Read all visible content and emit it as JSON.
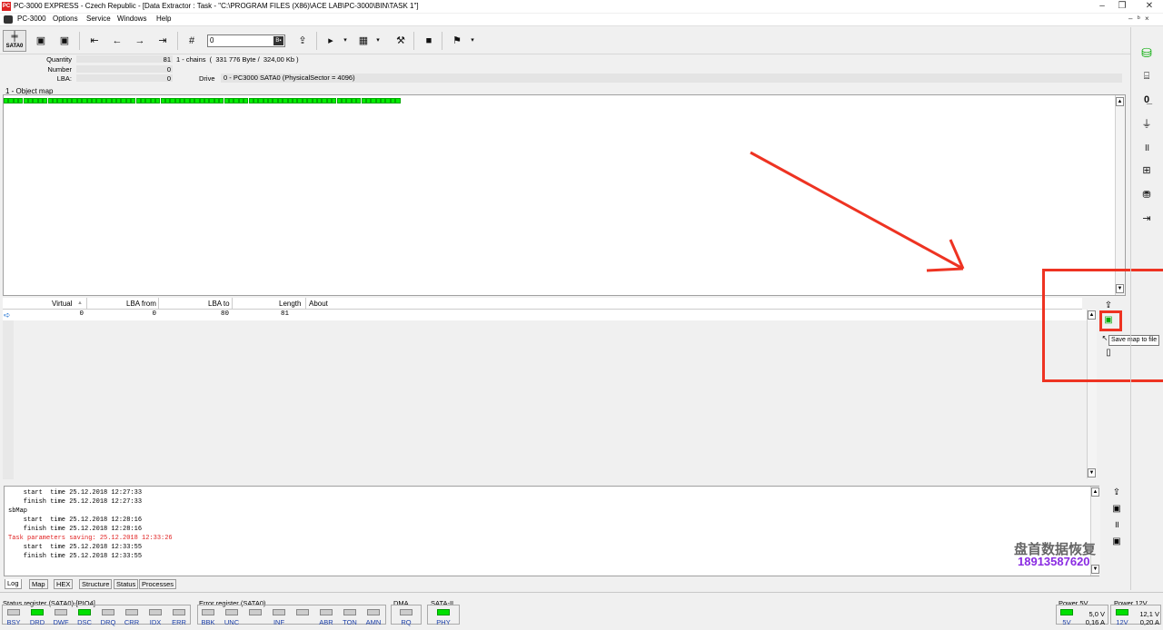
{
  "window": {
    "title": "PC-3000 EXPRESS - Czech Republic - [Data Extractor : Task - \"C:\\PROGRAM FILES (X86)\\ACE LAB\\PC-3000\\BIN\\TASK 1\"]",
    "app_icon_text": "PC",
    "minimize": "–",
    "restore": "❐",
    "close": "✕",
    "mdi_min": "–",
    "mdi_restore": "ᵇ",
    "mdi_close": "×"
  },
  "menu": {
    "items": [
      "PC-3000",
      "Options",
      "Service",
      "Windows",
      "Help"
    ]
  },
  "toolbar": {
    "sata_label": "SATA0",
    "counter_value": "0",
    "counter_btn": "B▪"
  },
  "info": {
    "quantity_label": "Quantity",
    "quantity_value": "81",
    "number_label": "Number",
    "number_value": "0",
    "lba_label": "LBA:",
    "lba_value": "0",
    "chains_text": "1 - chains  (  331 776 Byte /  324,00 Kb )",
    "drive_label": "Drive",
    "drive_value": "0 - PC3000 SATA0 (PhysicalSector = 4096)"
  },
  "object_map": {
    "label": "1 - Object map",
    "block_count": 81
  },
  "grid": {
    "columns": [
      "Virtual",
      "LBA from",
      "LBA to",
      "Length",
      "About"
    ],
    "row": {
      "virtual": "0",
      "lba_from": "0",
      "lba_to": "80",
      "length": "81",
      "about": ""
    }
  },
  "side_tools": {
    "tooltip": "Save map to file"
  },
  "log": {
    "lines": [
      {
        "text": "    start  time 25.12.2018 12:27:33",
        "color": "#000000"
      },
      {
        "text": "    finish time 25.12.2018 12:27:33",
        "color": "#000000"
      },
      {
        "text": "sbMap",
        "color": "#000000"
      },
      {
        "text": "    start  time 25.12.2018 12:28:16",
        "color": "#000000"
      },
      {
        "text": "    finish time 25.12.2018 12:28:16",
        "color": "#000000"
      },
      {
        "text": "Task parameters saving: 25.12.2018 12:33:26",
        "color": "#e02020"
      },
      {
        "text": "    start  time 25.12.2018 12:33:55",
        "color": "#000000"
      },
      {
        "text": "    finish time 25.12.2018 12:33:55",
        "color": "#000000"
      }
    ]
  },
  "tabs": [
    "Log",
    "Map",
    "HEX",
    "Structure",
    "Status",
    "Processes"
  ],
  "watermark": {
    "text": "盘首数据恢复",
    "phone": "18913587620"
  },
  "status": {
    "status_register_label": "Status register (SATA0)-[PIO4]",
    "status_leds": [
      {
        "label": "BSY",
        "on": false
      },
      {
        "label": "DRD",
        "on": true
      },
      {
        "label": "DWF",
        "on": false
      },
      {
        "label": "DSC",
        "on": true
      },
      {
        "label": "DRQ",
        "on": false
      },
      {
        "label": "CRR",
        "on": false
      },
      {
        "label": "IDX",
        "on": false
      },
      {
        "label": "ERR",
        "on": false
      }
    ],
    "error_register_label": "Error register (SATA0)",
    "error_leds": [
      {
        "label": "BBK",
        "on": false
      },
      {
        "label": "UNC",
        "on": false
      },
      {
        "label": "",
        "on": false
      },
      {
        "label": "INF",
        "on": false
      },
      {
        "label": "",
        "on": false
      },
      {
        "label": "ABR",
        "on": false
      },
      {
        "label": "TON",
        "on": false
      },
      {
        "label": "AMN",
        "on": false
      }
    ],
    "dma_label": "DMA",
    "dma_led": {
      "label": "RQ",
      "on": false
    },
    "sata2_label": "SATA-II",
    "sata2_led": {
      "label": "PHY",
      "on": true
    },
    "power5_label": "Power 5V",
    "power5_led": "5V",
    "power5_volt": "5,0 V",
    "power5_amp": "0,16 A",
    "power12_label": "Power 12V",
    "power12_led": "12V",
    "power12_volt": "12,1 V",
    "power12_amp": "0,20 A"
  },
  "colors": {
    "accent_red": "#e32222",
    "led_on": "#00e000",
    "block_green": "#00ee00",
    "led_text_blue": "#1a3ea8"
  }
}
